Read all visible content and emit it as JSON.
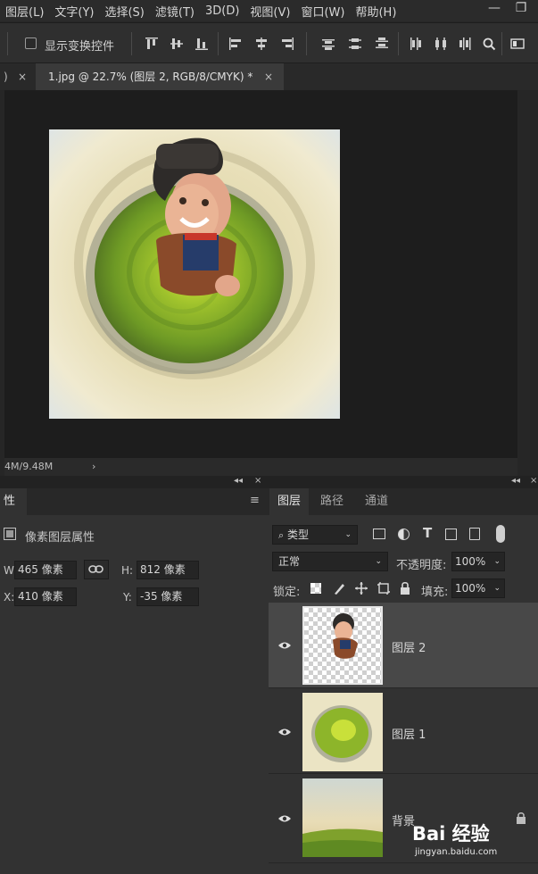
{
  "menubar": {
    "items": [
      "图层(L)",
      "文字(Y)",
      "选择(S)",
      "滤镜(T)",
      "3D(D)",
      "视图(V)",
      "窗口(W)",
      "帮助(H)"
    ],
    "minimize": "—",
    "restore": "❐"
  },
  "options_bar": {
    "show_transform_controls_label": "显示变换控件",
    "show_transform_controls_checked": false
  },
  "tabs": {
    "prev_tab_fragment": ")",
    "prev_close": "×",
    "active_tab_title": "1.jpg @ 22.7% (图层 2, RGB/8/CMYK) *",
    "active_close": "×"
  },
  "statusbar": {
    "doc_size": "4M/9.48M",
    "arrow": "›"
  },
  "dock": {
    "collapse_left": "◂◂",
    "close_left": "×",
    "collapse_right": "◂◂",
    "close_right": "×"
  },
  "properties": {
    "tab_label": "性",
    "menu_icon": "≡",
    "header_label": "像素图层属性",
    "w_label": "W:",
    "w_value": "465 像素",
    "h_label": "H:",
    "h_value": "812 像素",
    "x_label": "X:",
    "x_value": "410 像素",
    "y_label": "Y:",
    "y_value": "-35 像素"
  },
  "layers_panel": {
    "tabs": [
      "图层",
      "路径",
      "通道"
    ],
    "filter_kind": "类型",
    "blend_mode": "正常",
    "opacity_label": "不透明度:",
    "opacity_value": "100%",
    "lock_label": "锁定:",
    "fill_label": "填充:",
    "fill_value": "100%",
    "layers": [
      {
        "name": "图层 2",
        "visible": true,
        "selected": true,
        "locked": false
      },
      {
        "name": "图层 1",
        "visible": true,
        "selected": false,
        "locked": false
      },
      {
        "name": "背景",
        "visible": true,
        "selected": false,
        "locked": true
      }
    ]
  },
  "watermark": {
    "logo_text": "Bai 经验",
    "url": "jingyan.baidu.com"
  },
  "colors": {
    "accent": "#4a90d9",
    "panel_bg": "#323232",
    "canvas_bg": "#1d1d1d"
  }
}
